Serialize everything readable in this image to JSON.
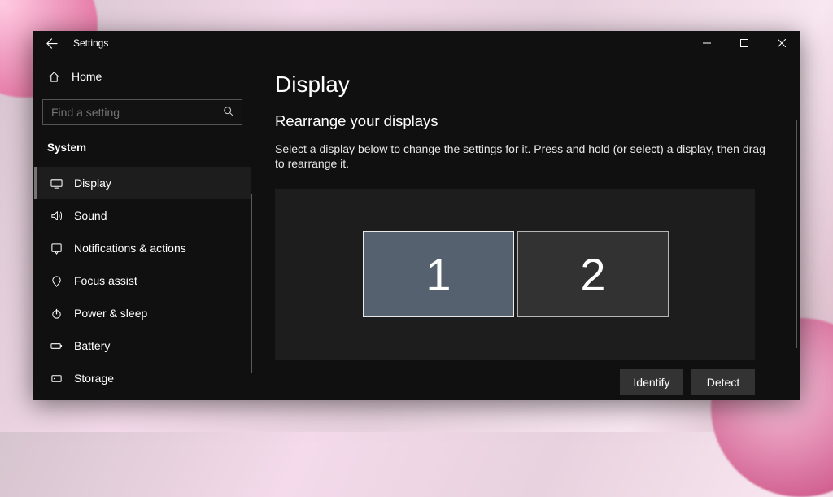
{
  "titlebar": {
    "title": "Settings"
  },
  "sidebar": {
    "home_label": "Home",
    "search_placeholder": "Find a setting",
    "category_label": "System",
    "items": [
      {
        "label": "Display"
      },
      {
        "label": "Sound"
      },
      {
        "label": "Notifications & actions"
      },
      {
        "label": "Focus assist"
      },
      {
        "label": "Power & sleep"
      },
      {
        "label": "Battery"
      },
      {
        "label": "Storage"
      }
    ]
  },
  "content": {
    "heading": "Display",
    "subheading": "Rearrange your displays",
    "description": "Select a display below to change the settings for it. Press and hold (or select) a display, then drag to rearrange it.",
    "displays": [
      {
        "label": "1"
      },
      {
        "label": "2"
      }
    ],
    "identify_label": "Identify",
    "detect_label": "Detect"
  }
}
